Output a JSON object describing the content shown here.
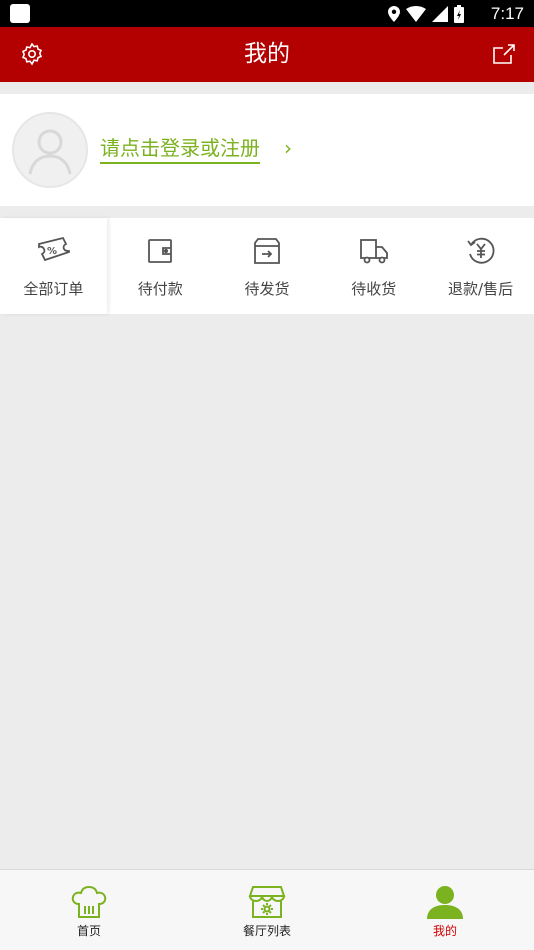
{
  "status_bar": {
    "time": "7:17"
  },
  "header": {
    "title": "我的"
  },
  "profile": {
    "login_text": "请点击登录或注册",
    "arrow": "›"
  },
  "orders": [
    {
      "label": "全部订单",
      "icon": "coupon-icon"
    },
    {
      "label": "待付款",
      "icon": "wallet-icon"
    },
    {
      "label": "待发货",
      "icon": "box-icon"
    },
    {
      "label": "待收货",
      "icon": "truck-icon"
    },
    {
      "label": "退款/售后",
      "icon": "refund-icon"
    }
  ],
  "tabs": [
    {
      "label": "首页",
      "icon": "chef-hat-icon"
    },
    {
      "label": "餐厅列表",
      "icon": "store-icon"
    },
    {
      "label": "我的",
      "icon": "user-icon"
    }
  ],
  "colors": {
    "header": "#b30000",
    "accent_green": "#7bb21f",
    "active_tab": "#d00000"
  }
}
